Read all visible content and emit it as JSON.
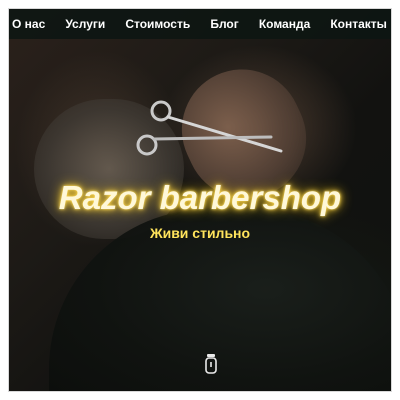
{
  "nav": {
    "items": [
      "О нас",
      "Услуги",
      "Стоимость",
      "Блог",
      "Команда",
      "Контакты"
    ]
  },
  "hero": {
    "title": "Razor barbershop",
    "subtitle": "Живи стильно",
    "scroll_icon": "trimmer-icon"
  },
  "colors": {
    "nav_bg": "#0c1612",
    "title_glow": "#ffd84a",
    "subtitle": "#ffe45c"
  }
}
